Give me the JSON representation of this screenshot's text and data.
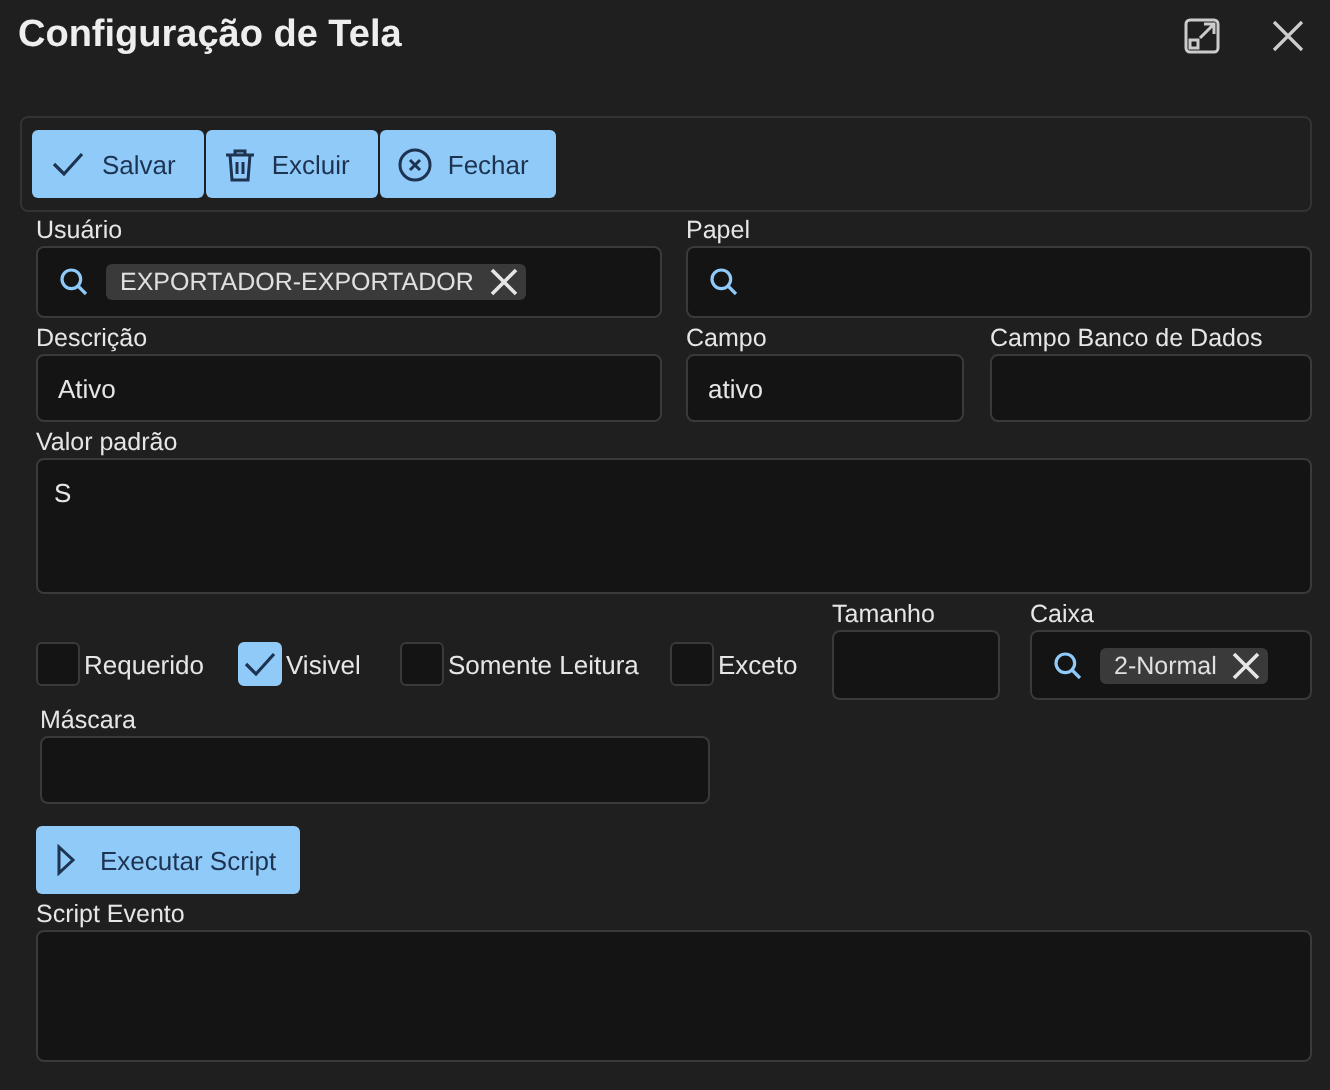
{
  "window": {
    "title": "Configuração de Tela"
  },
  "toolbar": [
    {
      "label": "Salvar"
    },
    {
      "label": "Excluir"
    },
    {
      "label": "Fechar"
    }
  ],
  "rows": [
    [
      {
        "kind": "search",
        "label": "Usuário",
        "chips": [
          "EXPORTADOR-EXPORTADOR"
        ]
      },
      {
        "kind": "search",
        "label": "Papel"
      }
    ],
    [
      {
        "kind": "text",
        "label": "Descrição",
        "value": "Ativo"
      },
      {
        "kind": "text",
        "label": "Campo",
        "value": "ativo"
      },
      {
        "kind": "text",
        "label": "Campo Banco de Dados"
      }
    ],
    [
      {
        "kind": "textarea",
        "label": "Valor padrão",
        "value": "S"
      }
    ],
    [
      {
        "kind": "checkbox",
        "label": "Requerido",
        "checked": false
      },
      {
        "kind": "checkbox",
        "label": "Visivel",
        "checked": true
      },
      {
        "kind": "checkbox",
        "label": "Somente Leitura",
        "checked": false
      },
      {
        "kind": "checkbox",
        "label": "Exceto",
        "checked": false
      },
      {
        "kind": "text",
        "label": "Tamanho"
      },
      {
        "kind": "search",
        "label": "Caixa",
        "chips": [
          "2-Normal"
        ]
      }
    ],
    [
      {
        "kind": "text",
        "label": "Máscara"
      }
    ],
    [
      {
        "kind": "button",
        "label": "Executar Script"
      }
    ],
    [
      {
        "kind": "textarea",
        "label": "Script Evento"
      }
    ]
  ]
}
